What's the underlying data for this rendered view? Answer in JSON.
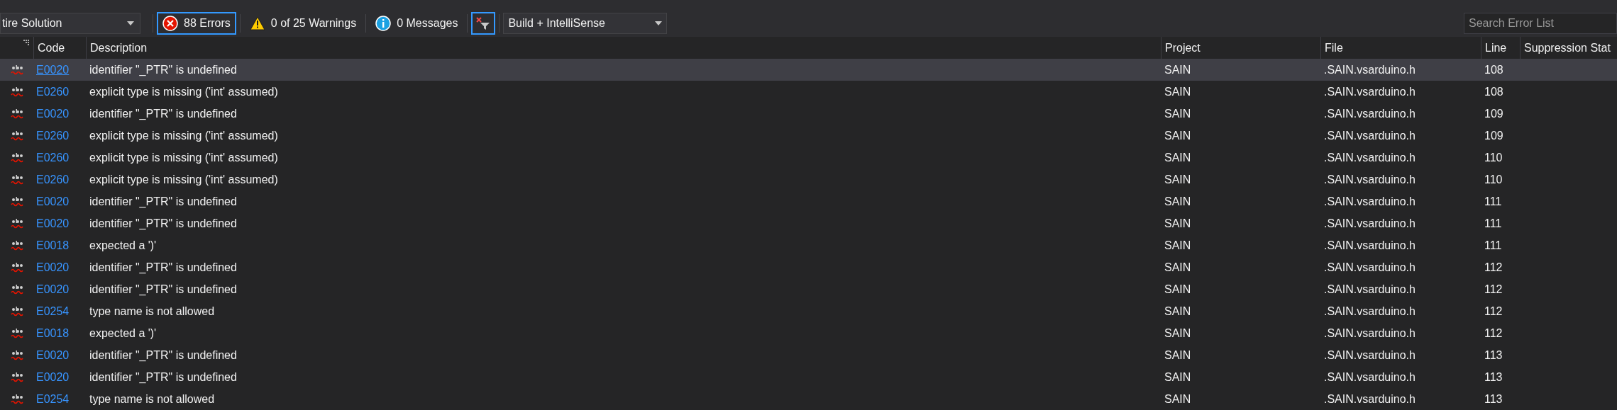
{
  "toolbar": {
    "scope_dropdown": {
      "value": "tire Solution"
    },
    "filters": [
      {
        "kind": "error",
        "label": "88 Errors",
        "selected": true
      },
      {
        "kind": "warning",
        "label": "0 of 25 Warnings",
        "selected": false
      },
      {
        "kind": "info",
        "label": "0 Messages",
        "selected": false
      }
    ],
    "clear_filter_button": {
      "selected": true
    },
    "source_dropdown": {
      "value": "Build + IntelliSense"
    },
    "search": {
      "placeholder": "Search Error List"
    }
  },
  "table": {
    "columns": [
      "Code",
      "Description",
      "Project",
      "File",
      "Line",
      "Suppression Stat"
    ],
    "rows": [
      {
        "code": "E0020",
        "description": "identifier \"_PTR\" is undefined",
        "project": "SAIN",
        "file": ".SAIN.vsarduino.h",
        "line": "108",
        "selected": true
      },
      {
        "code": "E0260",
        "description": "explicit type is missing ('int' assumed)",
        "project": "SAIN",
        "file": ".SAIN.vsarduino.h",
        "line": "108",
        "selected": false
      },
      {
        "code": "E0020",
        "description": "identifier \"_PTR\" is undefined",
        "project": "SAIN",
        "file": ".SAIN.vsarduino.h",
        "line": "109",
        "selected": false
      },
      {
        "code": "E0260",
        "description": "explicit type is missing ('int' assumed)",
        "project": "SAIN",
        "file": ".SAIN.vsarduino.h",
        "line": "109",
        "selected": false
      },
      {
        "code": "E0260",
        "description": "explicit type is missing ('int' assumed)",
        "project": "SAIN",
        "file": ".SAIN.vsarduino.h",
        "line": "110",
        "selected": false
      },
      {
        "code": "E0260",
        "description": "explicit type is missing ('int' assumed)",
        "project": "SAIN",
        "file": ".SAIN.vsarduino.h",
        "line": "110",
        "selected": false
      },
      {
        "code": "E0020",
        "description": "identifier \"_PTR\" is undefined",
        "project": "SAIN",
        "file": ".SAIN.vsarduino.h",
        "line": "111",
        "selected": false
      },
      {
        "code": "E0020",
        "description": "identifier \"_PTR\" is undefined",
        "project": "SAIN",
        "file": ".SAIN.vsarduino.h",
        "line": "111",
        "selected": false
      },
      {
        "code": "E0018",
        "description": "expected a ')'",
        "project": "SAIN",
        "file": ".SAIN.vsarduino.h",
        "line": "111",
        "selected": false
      },
      {
        "code": "E0020",
        "description": "identifier \"_PTR\" is undefined",
        "project": "SAIN",
        "file": ".SAIN.vsarduino.h",
        "line": "112",
        "selected": false
      },
      {
        "code": "E0020",
        "description": "identifier \"_PTR\" is undefined",
        "project": "SAIN",
        "file": ".SAIN.vsarduino.h",
        "line": "112",
        "selected": false
      },
      {
        "code": "E0254",
        "description": "type name is not allowed",
        "project": "SAIN",
        "file": ".SAIN.vsarduino.h",
        "line": "112",
        "selected": false
      },
      {
        "code": "E0018",
        "description": "expected a ')'",
        "project": "SAIN",
        "file": ".SAIN.vsarduino.h",
        "line": "112",
        "selected": false
      },
      {
        "code": "E0020",
        "description": "identifier \"_PTR\" is undefined",
        "project": "SAIN",
        "file": ".SAIN.vsarduino.h",
        "line": "113",
        "selected": false
      },
      {
        "code": "E0020",
        "description": "identifier \"_PTR\" is undefined",
        "project": "SAIN",
        "file": ".SAIN.vsarduino.h",
        "line": "113",
        "selected": false
      },
      {
        "code": "E0254",
        "description": "type name is not allowed",
        "project": "SAIN",
        "file": ".SAIN.vsarduino.h",
        "line": "113",
        "selected": false
      }
    ]
  }
}
